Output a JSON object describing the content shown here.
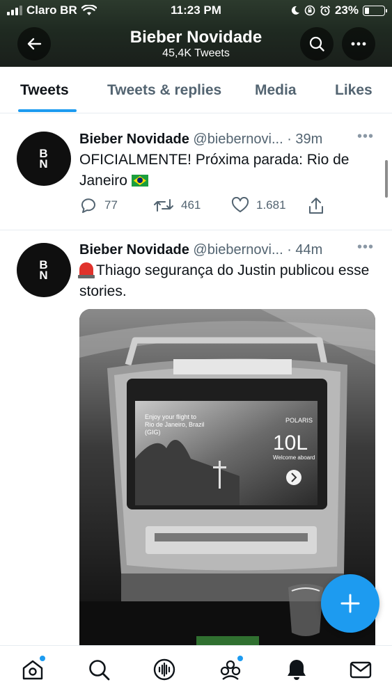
{
  "status_bar": {
    "carrier": "Claro BR",
    "time": "11:23 PM",
    "battery": "23%"
  },
  "header": {
    "title": "Bieber Novidade",
    "subtitle": "45,4K Tweets"
  },
  "tabs": [
    {
      "label": "Tweets",
      "active": true
    },
    {
      "label": "Tweets & replies",
      "active": false
    },
    {
      "label": "Media",
      "active": false
    },
    {
      "label": "Likes",
      "active": false
    }
  ],
  "avatar": {
    "line1": "B",
    "line2": "N"
  },
  "tweets": [
    {
      "name": "Bieber Novidade",
      "handle": "@biebernovi...",
      "time": "· 39m",
      "more": "•••",
      "text": "OFICIALMENTE! Próxima parada: Rio de Janeiro",
      "emoji": "brazil-flag",
      "replies": "77",
      "retweets": "461",
      "likes": "1.681"
    },
    {
      "name": "Bieber Novidade",
      "handle": "@biebernovi...",
      "time": "· 44m",
      "more": "•••",
      "emoji": "rotating-light",
      "text": "Thiago segurança do Justin publicou esse stories."
    }
  ],
  "media_screen": {
    "line1": "Enjoy your flight to",
    "line2": "Rio de Janeiro, Brazil",
    "line3": "(GIG)",
    "brand": "POLARIS",
    "seat": "10L",
    "welcome": "Welcome aboard"
  },
  "colors": {
    "accent": "#1d9bf0",
    "text": "#0f1419",
    "muted": "#536471"
  },
  "nav": {
    "items": [
      "home-icon",
      "search-icon",
      "spaces-icon",
      "communities-icon",
      "notifications-icon",
      "messages-icon"
    ]
  }
}
